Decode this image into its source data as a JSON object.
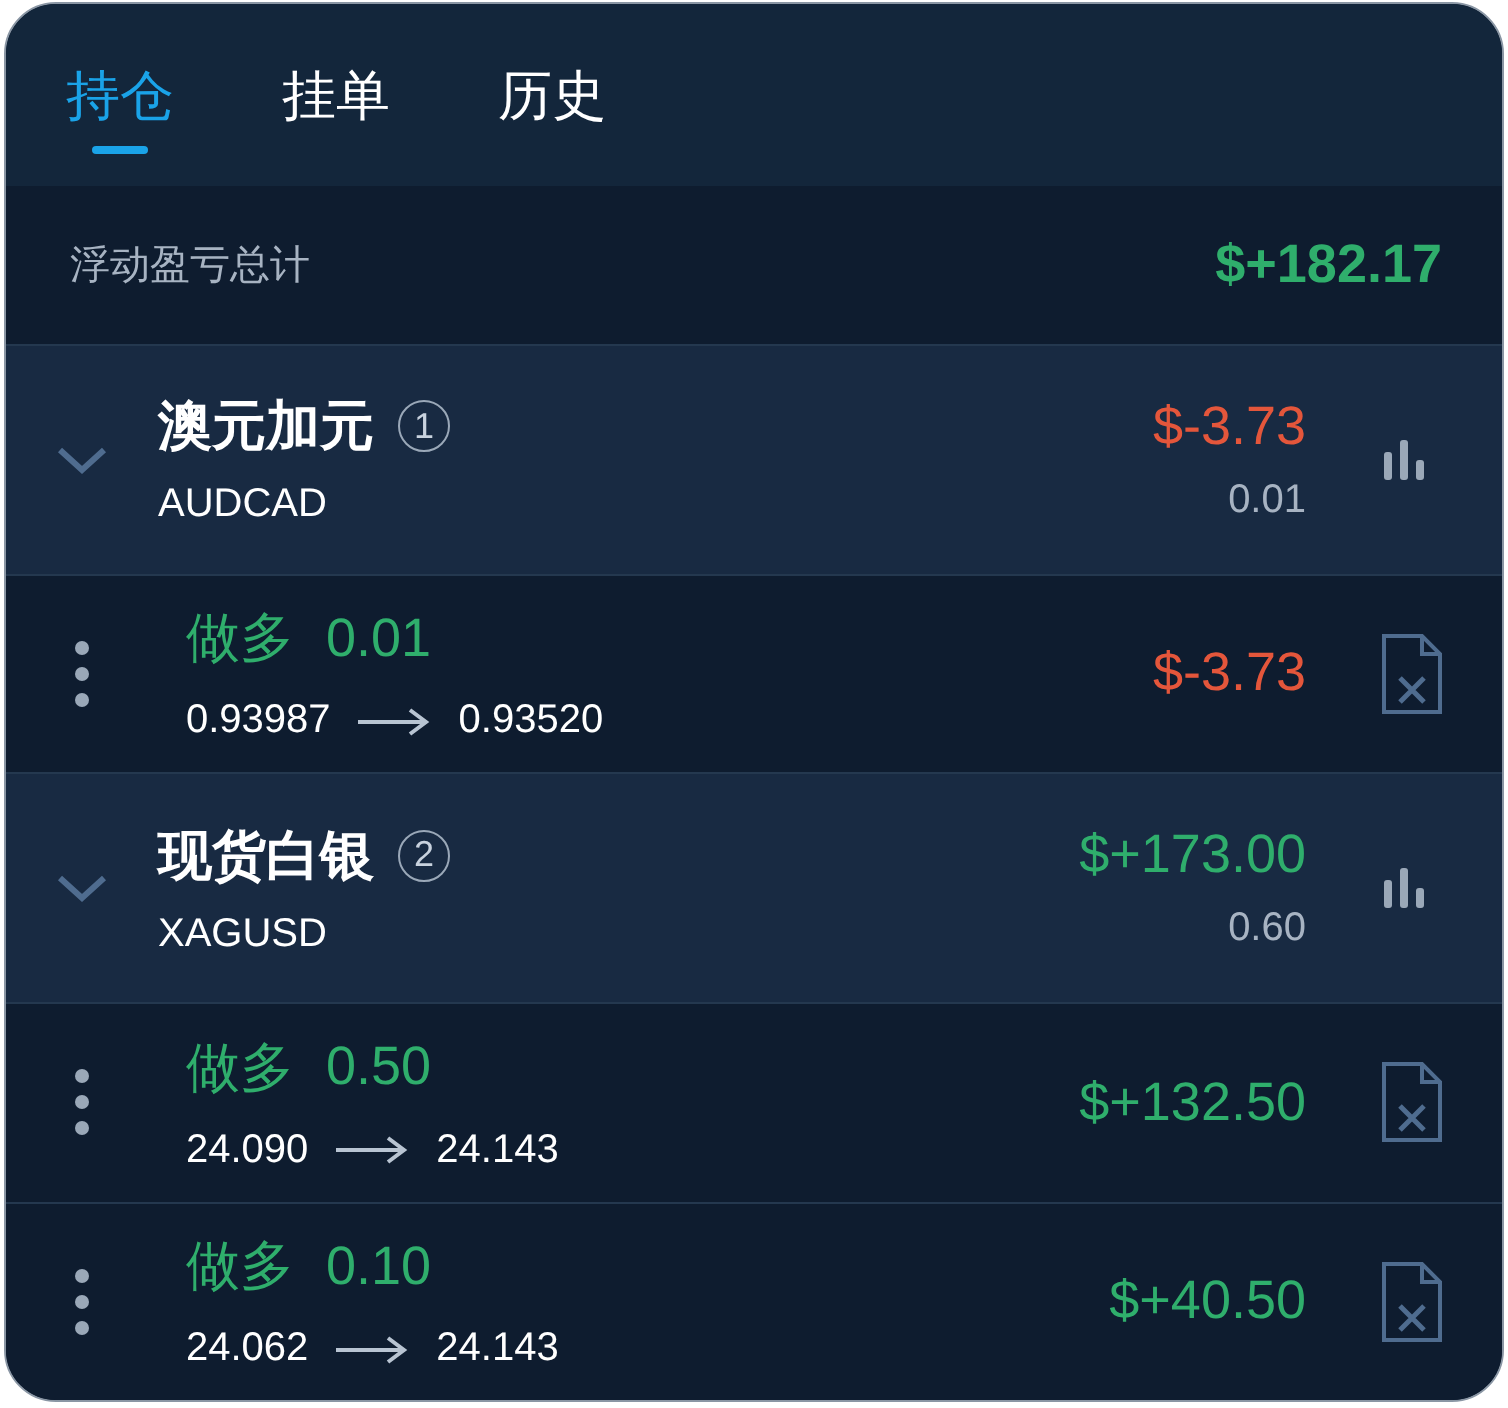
{
  "tabs": [
    {
      "label": "持仓",
      "selected": true
    },
    {
      "label": "挂单",
      "selected": false
    },
    {
      "label": "历史",
      "selected": false
    }
  ],
  "summary": {
    "label": "浮动盈亏总计",
    "value": "$+182.17",
    "color": "#2fae6c"
  },
  "groups": [
    {
      "name": "澳元加元",
      "count": "1",
      "symbol": "AUDCAD",
      "pnl": "$-3.73",
      "color": "#e4563b",
      "volume": "0.01",
      "expanded": true,
      "children": [
        {
          "side": "做多",
          "lots": "0.01",
          "open": "0.93987",
          "current": "0.93520",
          "pnl": "$-3.73",
          "color": "#e4563b"
        }
      ]
    },
    {
      "name": "现货白银",
      "count": "2",
      "symbol": "XAGUSD",
      "pnl": "$+173.00",
      "color": "#2fae6c",
      "volume": "0.60",
      "expanded": true,
      "children": [
        {
          "side": "做多",
          "lots": "0.50",
          "open": "24.090",
          "current": "24.143",
          "pnl": "$+132.50",
          "color": "#2fae6c"
        },
        {
          "side": "做多",
          "lots": "0.10",
          "open": "24.062",
          "current": "24.143",
          "pnl": "$+40.50",
          "color": "#2fae6c"
        }
      ]
    }
  ]
}
